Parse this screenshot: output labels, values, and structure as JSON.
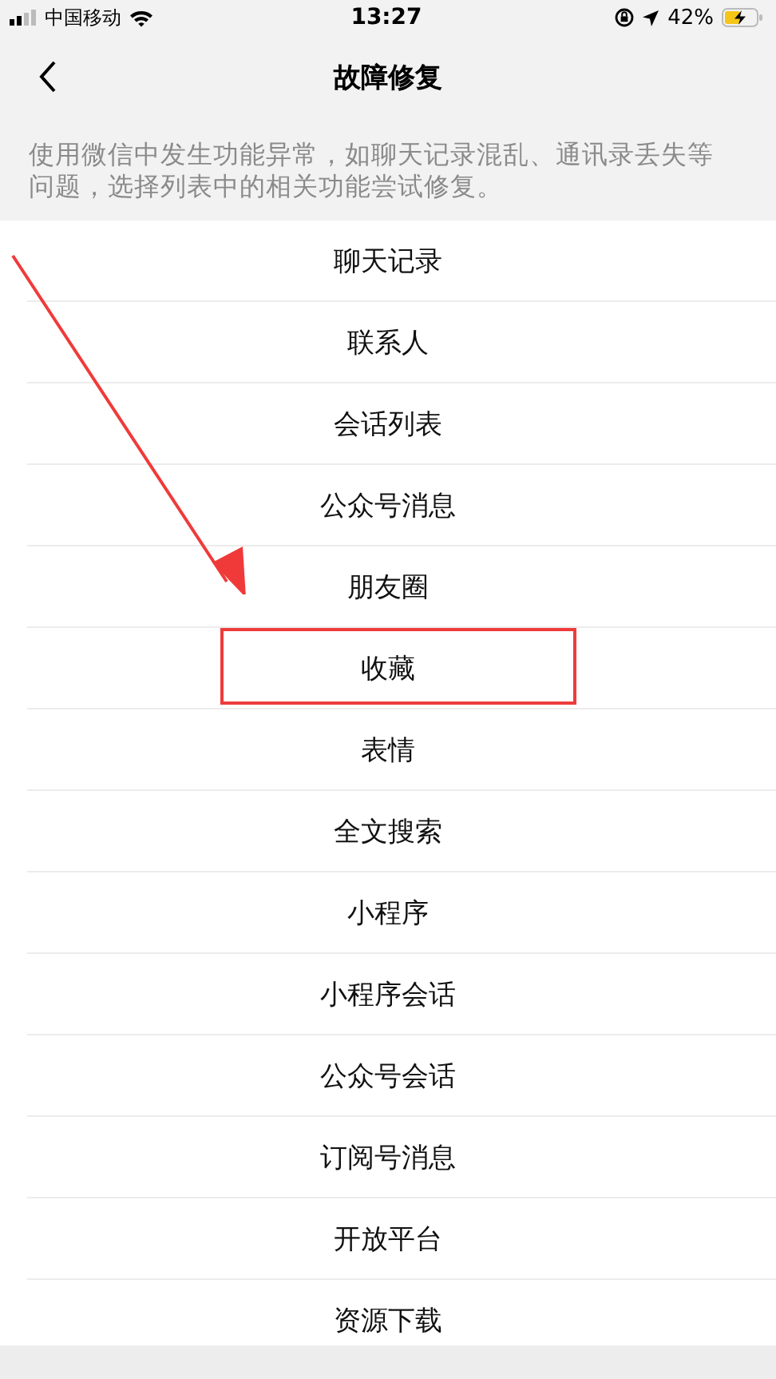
{
  "status_bar": {
    "carrier": "中国移动",
    "time": "13:27",
    "battery": "42%"
  },
  "nav": {
    "title": "故障修复"
  },
  "description": "使用微信中发生功能异常，如聊天记录混乱、通讯录丢失等问题，选择列表中的相关功能尝试修复。",
  "items": [
    {
      "label": "聊天记录",
      "highlighted": false
    },
    {
      "label": "联系人",
      "highlighted": false
    },
    {
      "label": "会话列表",
      "highlighted": false
    },
    {
      "label": "公众号消息",
      "highlighted": false
    },
    {
      "label": "朋友圈",
      "highlighted": false
    },
    {
      "label": "收藏",
      "highlighted": true
    },
    {
      "label": "表情",
      "highlighted": false
    },
    {
      "label": "全文搜索",
      "highlighted": false
    },
    {
      "label": "小程序",
      "highlighted": false
    },
    {
      "label": "小程序会话",
      "highlighted": false
    },
    {
      "label": "公众号会话",
      "highlighted": false
    },
    {
      "label": "订阅号消息",
      "highlighted": false
    },
    {
      "label": "开放平台",
      "highlighted": false
    },
    {
      "label": "资源下载",
      "highlighted": false
    }
  ]
}
